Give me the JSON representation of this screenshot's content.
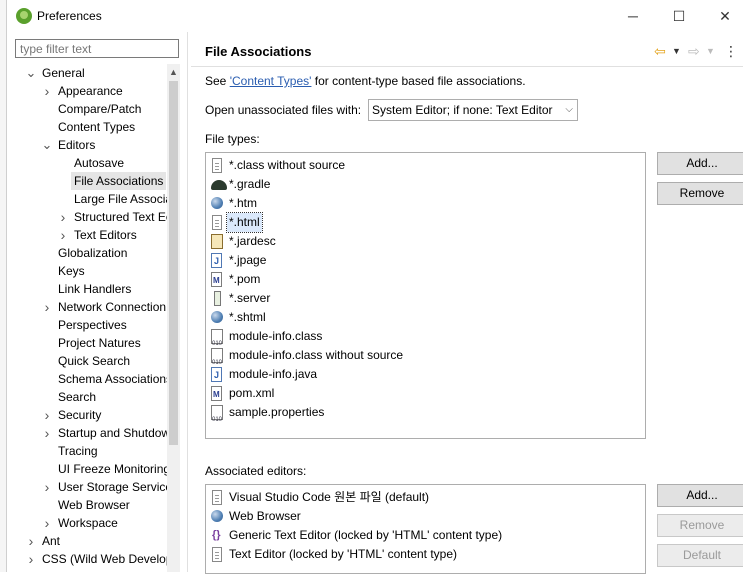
{
  "window": {
    "title": "Preferences",
    "minimize": "─",
    "maximize": "☐",
    "close": "✕"
  },
  "left_pane": {
    "filter_placeholder": "type filter text",
    "tree": [
      {
        "label": "General",
        "level": 0,
        "expand": "open"
      },
      {
        "label": "Appearance",
        "level": 1,
        "expand": "closed"
      },
      {
        "label": "Compare/Patch",
        "level": 1,
        "expand": "none"
      },
      {
        "label": "Content Types",
        "level": 1,
        "expand": "none"
      },
      {
        "label": "Editors",
        "level": 1,
        "expand": "open"
      },
      {
        "label": "Autosave",
        "level": 2,
        "expand": "none"
      },
      {
        "label": "File Associations",
        "level": 2,
        "expand": "none",
        "selected": true
      },
      {
        "label": "Large File Associa",
        "level": 2,
        "expand": "none"
      },
      {
        "label": "Structured Text Ec",
        "level": 2,
        "expand": "closed"
      },
      {
        "label": "Text Editors",
        "level": 2,
        "expand": "closed"
      },
      {
        "label": "Globalization",
        "level": 1,
        "expand": "none"
      },
      {
        "label": "Keys",
        "level": 1,
        "expand": "none"
      },
      {
        "label": "Link Handlers",
        "level": 1,
        "expand": "none"
      },
      {
        "label": "Network Connection",
        "level": 1,
        "expand": "closed"
      },
      {
        "label": "Perspectives",
        "level": 1,
        "expand": "none"
      },
      {
        "label": "Project Natures",
        "level": 1,
        "expand": "none"
      },
      {
        "label": "Quick Search",
        "level": 1,
        "expand": "none"
      },
      {
        "label": "Schema Associations",
        "level": 1,
        "expand": "none"
      },
      {
        "label": "Search",
        "level": 1,
        "expand": "none"
      },
      {
        "label": "Security",
        "level": 1,
        "expand": "closed"
      },
      {
        "label": "Startup and Shutdow",
        "level": 1,
        "expand": "closed"
      },
      {
        "label": "Tracing",
        "level": 1,
        "expand": "none"
      },
      {
        "label": "UI Freeze Monitoring",
        "level": 1,
        "expand": "none"
      },
      {
        "label": "User Storage Service",
        "level": 1,
        "expand": "closed"
      },
      {
        "label": "Web Browser",
        "level": 1,
        "expand": "none"
      },
      {
        "label": "Workspace",
        "level": 1,
        "expand": "closed"
      },
      {
        "label": "Ant",
        "level": 0,
        "expand": "closed"
      },
      {
        "label": "CSS (Wild Web Develop",
        "level": 0,
        "expand": "closed"
      }
    ]
  },
  "page": {
    "title": "File Associations",
    "see_prefix": "See ",
    "see_link": "'Content Types'",
    "see_suffix": " for content-type based file associations.",
    "open_label": "Open unassociated files with:",
    "open_value": "System Editor; if none: Text Editor",
    "file_types_label": "File types:",
    "file_types": [
      {
        "label": "*.class without source",
        "icon": "file-icon"
      },
      {
        "label": "*.gradle",
        "icon": "gradle-icon"
      },
      {
        "label": "*.htm",
        "icon": "globe-icon"
      },
      {
        "label": "*.html",
        "icon": "file-icon",
        "selected": true
      },
      {
        "label": "*.jardesc",
        "icon": "jar-icon"
      },
      {
        "label": "*.jpage",
        "icon": "java-icon"
      },
      {
        "label": "*.pom",
        "icon": "maven-icon"
      },
      {
        "label": "*.server",
        "icon": "server-icon"
      },
      {
        "label": "*.shtml",
        "icon": "globe-icon"
      },
      {
        "label": "module-info.class",
        "icon": "binary-icon"
      },
      {
        "label": "module-info.class without source",
        "icon": "binary-icon"
      },
      {
        "label": "module-info.java",
        "icon": "java-icon"
      },
      {
        "label": "pom.xml",
        "icon": "maven-icon"
      },
      {
        "label": "sample.properties",
        "icon": "binary-icon"
      }
    ],
    "add_label": "Add...",
    "remove_label": "Remove",
    "assoc_label": "Associated editors:",
    "assoc_editors": [
      {
        "label": "Visual Studio Code 원본 파일 (default)",
        "icon": "file-icon"
      },
      {
        "label": "Web Browser",
        "icon": "globe-icon"
      },
      {
        "label": "Generic Text Editor (locked by 'HTML' content type)",
        "icon": "brace-icon"
      },
      {
        "label": "Text Editor (locked by 'HTML' content type)",
        "icon": "file-icon"
      }
    ],
    "assoc_add_label": "Add...",
    "assoc_remove_label": "Remove",
    "assoc_default_label": "Default"
  }
}
